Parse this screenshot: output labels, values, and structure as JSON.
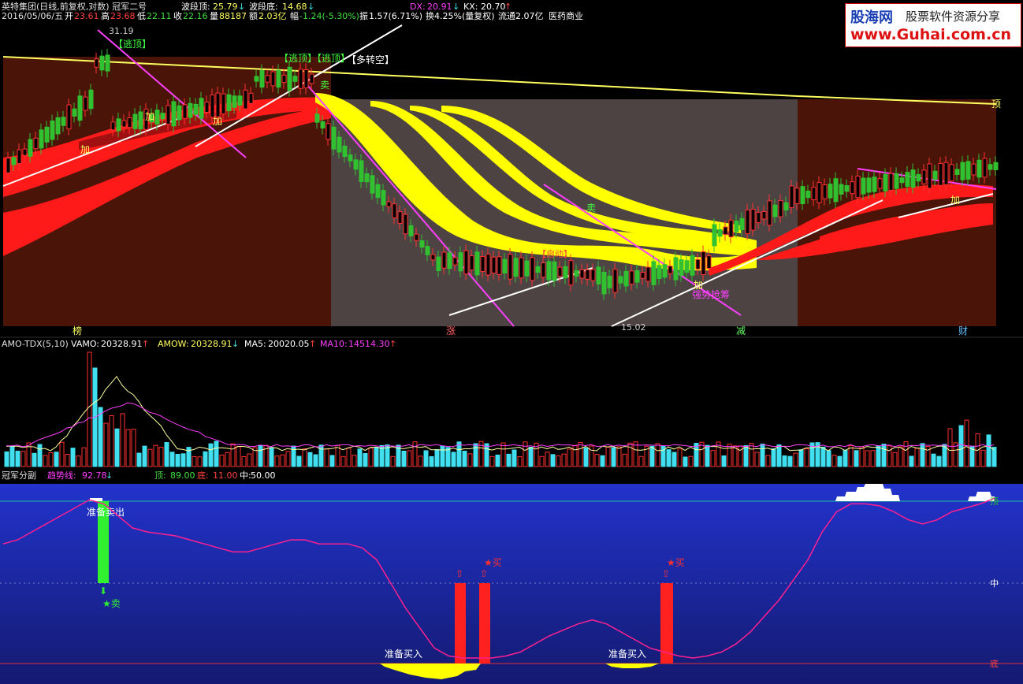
{
  "header": {
    "title": "英特集团(日线,前复权,对数) 冠军二号",
    "wave_top_label": "波段顶:",
    "wave_top": "25.79",
    "wave_bot_label": "波段底:",
    "wave_bot": "14.68",
    "dx_label": "DX:",
    "dx": "20.91",
    "kx_label": "KX:",
    "kx": "20.70",
    "date": "2016/05/06/五",
    "open_label": "开",
    "open": "23.61",
    "high_label": "高",
    "high": "23.68",
    "low_label": "低",
    "low": "22.11",
    "close_label": "收",
    "close": "22.16",
    "vol_label": "量",
    "vol": "88187",
    "amt_label": "额",
    "amt": "2.03亿",
    "chg_label": "幅",
    "chg": "-1.24(-5.30%)",
    "amp_label": "振",
    "amp": "1.57(6.71%)",
    "turn": "换4.25%(量复权)",
    "float": "流通2.07亿",
    "industry": "医药商业"
  },
  "watermark": {
    "t1": "股海网",
    "t2": "股票软件资源分享",
    "t3": "www.Guhai.com.cn"
  },
  "main_labels": {
    "price_high": "31.19",
    "price_low": "15.02",
    "escape1": "【逃顶】",
    "escape2": "【逃顶】【逃顶】",
    "multi_short": "【多转空】",
    "add": "加",
    "sell": "卖",
    "buy_zone": "【启动】",
    "strong_buy": "强势抢筹",
    "top": "顶",
    "zone1": "榜",
    "zone2": "涨",
    "zone3": "减",
    "zone4": "财"
  },
  "volume_header": {
    "name": "AMO-TDX(5,10)",
    "vamo_label": "VAMO:",
    "vamo": "20328.91",
    "amow_label": "AMOW:",
    "amow": "20328.91",
    "ma5_label": "MA5:",
    "ma5": "20020.05",
    "ma10_label": "MA10:",
    "ma10": "14514.30"
  },
  "osc_header": {
    "name": "冠军分副",
    "trend_label": "趋势线:",
    "trend": "92.78",
    "top_label": "顶:",
    "top": "89.00",
    "bot_label": "底:",
    "bot": "11.00",
    "mid_label": "中:",
    "mid": "50.00"
  },
  "osc_labels": {
    "prepare_sell": "准备卖出",
    "sell": "★卖",
    "buy": "★买",
    "prepare_buy1": "准备买入",
    "prepare_buy2": "准备买入",
    "axis_top": "顶",
    "axis_mid": "中",
    "axis_bot": "底"
  },
  "colors": {
    "bg": "#000000",
    "up": "#ff2020",
    "down": "#20e0e0",
    "candle_up": "#ff3030",
    "candle_down": "#30c030",
    "band_red": "#ff1a1a",
    "band_yellow": "#ffff00",
    "zone_dark": "#4a1508",
    "zone_gray": "#4a4040",
    "magenta": "#ff40ff",
    "osc_bg": "#1a2ab0"
  },
  "chart_data": [
    {
      "type": "line",
      "title": "英特集团(日线,前复权,对数) 冠军二号",
      "annotations": {
        "max": 31.19,
        "min": 15.02,
        "wave_top": 25.79,
        "wave_bottom": 14.68,
        "dx": 20.91,
        "kx": 20.7
      },
      "ohlc_last": {
        "open": 23.61,
        "high": 23.68,
        "low": 22.11,
        "close": 22.16
      }
    },
    {
      "type": "bar",
      "title": "AMO-TDX(5,10)",
      "series": [
        {
          "name": "VAMO",
          "values": [
            20328.91
          ]
        },
        {
          "name": "AMOW",
          "values": [
            20328.91
          ]
        },
        {
          "name": "MA5",
          "values": [
            20020.05
          ]
        },
        {
          "name": "MA10",
          "values": [
            14514.3
          ]
        }
      ]
    },
    {
      "type": "line",
      "title": "冠军分副",
      "series": [
        {
          "name": "趋势线",
          "values": [
            70,
            72,
            76,
            80,
            84,
            88,
            92,
            90,
            84,
            78,
            76,
            75,
            74,
            72,
            70,
            68,
            66,
            66,
            68,
            70,
            72,
            72,
            70,
            70,
            70,
            68,
            62,
            50,
            38,
            28,
            18,
            14,
            13,
            13,
            13,
            14,
            16,
            20,
            24,
            27,
            30,
            32,
            30,
            26,
            22,
            18,
            16,
            14,
            13,
            14,
            16,
            20,
            26,
            34,
            42,
            52,
            62,
            76,
            86,
            90,
            90,
            89,
            86,
            82,
            80,
            82,
            86,
            88,
            90,
            92.78
          ]
        }
      ],
      "ylim": [
        0,
        100
      ],
      "levels": {
        "top": 89,
        "mid": 50,
        "bottom": 11
      }
    }
  ]
}
